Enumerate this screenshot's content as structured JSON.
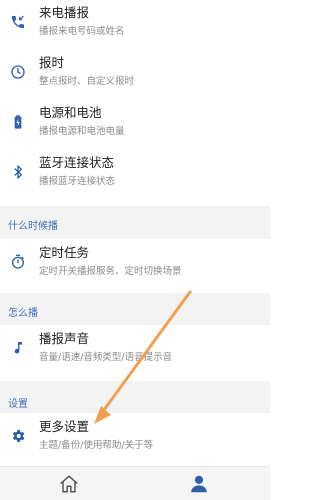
{
  "items": [
    {
      "title": "来电播报",
      "subtitle": "播报来电号码或姓名",
      "icon": "phone-incoming-icon"
    },
    {
      "title": "报时",
      "subtitle": "整点报时、自定义报时",
      "icon": "clock-icon"
    },
    {
      "title": "电源和电池",
      "subtitle": "播报电源和电池电量",
      "icon": "battery-icon"
    },
    {
      "title": "蓝牙连接状态",
      "subtitle": "播报蓝牙连接状态",
      "icon": "bluetooth-icon"
    }
  ],
  "sections": {
    "when": {
      "label": "什么时候播",
      "items": [
        {
          "title": "定时任务",
          "subtitle": "定时开关播报服务、定时切换场景",
          "icon": "timer-icon"
        }
      ]
    },
    "how": {
      "label": "怎么播",
      "items": [
        {
          "title": "播报声音",
          "subtitle": "音量/语速/音频类型/语音提示音",
          "icon": "music-note-icon"
        }
      ]
    },
    "settings": {
      "label": "设置",
      "items": [
        {
          "title": "更多设置",
          "subtitle": "主题/备份/使用帮助/关于等",
          "icon": "gear-icon"
        }
      ]
    }
  },
  "bottom_nav": {
    "items": [
      {
        "icon": "home-icon",
        "active": false
      },
      {
        "icon": "person-icon",
        "active": true
      }
    ]
  },
  "colors": {
    "icon_blue": "#2f5fa7",
    "section_label": "#3d6cb4",
    "section_bg": "#f3f3f3",
    "annotation_arrow": "#f0a050"
  }
}
